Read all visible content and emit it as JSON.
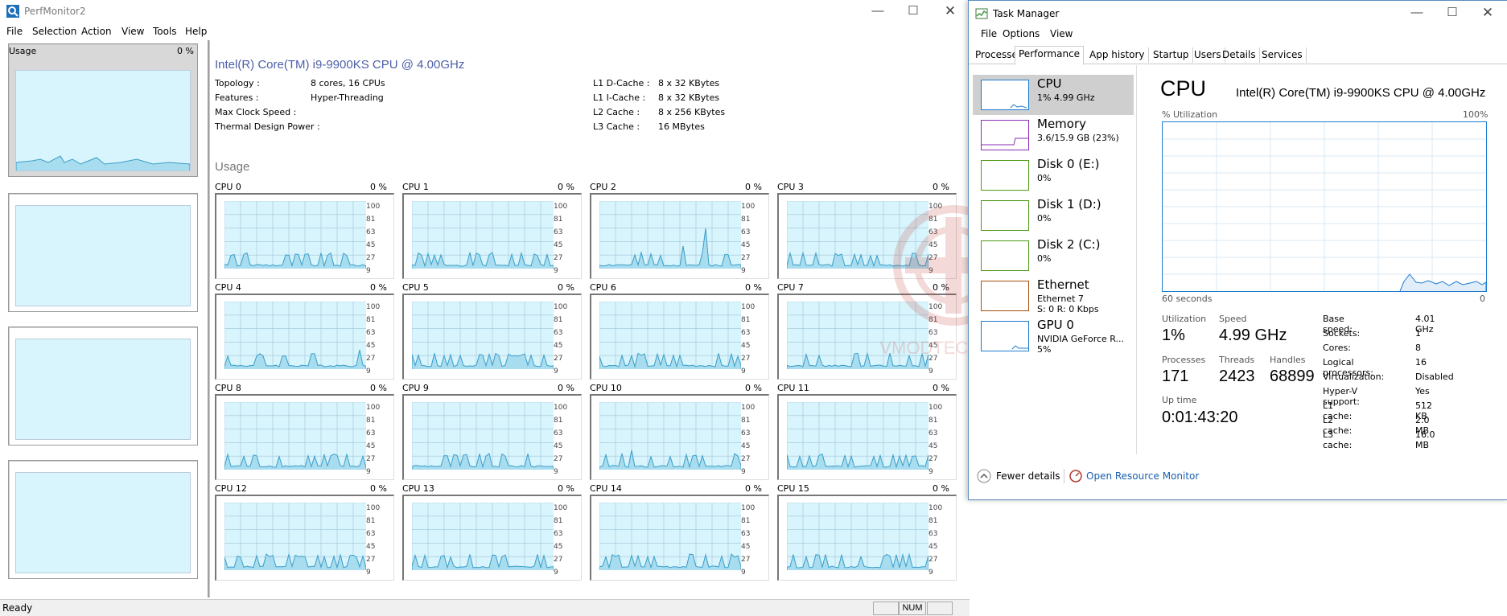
{
  "perfmonitor": {
    "title": "PerfMonitor2",
    "menu": [
      "File",
      "Selection",
      "Action",
      "View",
      "Tools",
      "Help"
    ],
    "left_panel": {
      "label": "Usage",
      "value": "0 %"
    },
    "cpu_name": "Intel(R) Core(TM) i9-9900KS CPU @ 4.00GHz",
    "specs_left": [
      {
        "k": "Topology :",
        "v": "8 cores, 16 CPUs"
      },
      {
        "k": "Features :",
        "v": "Hyper-Threading"
      },
      {
        "k": "Max Clock Speed :",
        "v": ""
      },
      {
        "k": "Thermal Design Power :",
        "v": ""
      }
    ],
    "specs_right": [
      {
        "k": "L1 D-Cache :",
        "v": "8 x 32 KBytes"
      },
      {
        "k": "L1 I-Cache :",
        "v": "8 x 32 KBytes"
      },
      {
        "k": "L2 Cache :",
        "v": "8 x 256 KBytes"
      },
      {
        "k": "L3 Cache :",
        "v": "16 MBytes"
      }
    ],
    "usage_heading": "Usage",
    "axis": [
      "100",
      "81",
      "63",
      "45",
      "27",
      "9"
    ],
    "cores": [
      {
        "label": "CPU 0",
        "value": "0 %"
      },
      {
        "label": "CPU 1",
        "value": "0 %"
      },
      {
        "label": "CPU 2",
        "value": "0 %"
      },
      {
        "label": "CPU 3",
        "value": "0 %"
      },
      {
        "label": "CPU 4",
        "value": "0 %"
      },
      {
        "label": "CPU 5",
        "value": "0 %"
      },
      {
        "label": "CPU 6",
        "value": "0 %"
      },
      {
        "label": "CPU 7",
        "value": "0 %"
      },
      {
        "label": "CPU 8",
        "value": "0 %"
      },
      {
        "label": "CPU 9",
        "value": "0 %"
      },
      {
        "label": "CPU 10",
        "value": "0 %"
      },
      {
        "label": "CPU 11",
        "value": "0 %"
      },
      {
        "label": "CPU 12",
        "value": "0 %"
      },
      {
        "label": "CPU 13",
        "value": "0 %"
      },
      {
        "label": "CPU 14",
        "value": "0 %"
      },
      {
        "label": "CPU 15",
        "value": "0 %"
      }
    ],
    "status": {
      "ready": "Ready",
      "num": "NUM"
    }
  },
  "taskmanager": {
    "title": "Task Manager",
    "menu": [
      "File",
      "Options",
      "View"
    ],
    "tabs": [
      "Processes",
      "Performance",
      "App history",
      "Startup",
      "Users",
      "Details",
      "Services"
    ],
    "active_tab": "Performance",
    "resources": [
      {
        "name": "CPU",
        "sub1": "1% 4.99 GHz",
        "sub2": "",
        "color": "#1b7bcf"
      },
      {
        "name": "Memory",
        "sub1": "3.6/15.9 GB (23%)",
        "sub2": "",
        "color": "#8b2bb8"
      },
      {
        "name": "Disk 0 (E:)",
        "sub1": "0%",
        "sub2": "",
        "color": "#4d9a16"
      },
      {
        "name": "Disk 1 (D:)",
        "sub1": "0%",
        "sub2": "",
        "color": "#4d9a16"
      },
      {
        "name": "Disk 2 (C:)",
        "sub1": "0%",
        "sub2": "",
        "color": "#4d9a16"
      },
      {
        "name": "Ethernet",
        "sub1": "Ethernet 7",
        "sub2": "S: 0 R: 0 Kbps",
        "color": "#a74f0b"
      },
      {
        "name": "GPU 0",
        "sub1": "NVIDIA GeForce R...",
        "sub2": "5%",
        "color": "#1b7bcf"
      }
    ],
    "cpu_heading": "CPU",
    "cpu_name": "Intel(R) Core(TM) i9-9900KS CPU @ 4.00GHz",
    "graph": {
      "top_left": "% Utilization",
      "top_right": "100%",
      "bottom_left": "60 seconds",
      "bottom_right": "0"
    },
    "stats": {
      "utilization_label": "Utilization",
      "utilization": "1%",
      "speed_label": "Speed",
      "speed": "4.99 GHz",
      "processes_label": "Processes",
      "processes": "171",
      "threads_label": "Threads",
      "threads": "2423",
      "handles_label": "Handles",
      "handles": "68899",
      "uptime_label": "Up time",
      "uptime": "0:01:43:20"
    },
    "specs": [
      {
        "k": "Base speed:",
        "v": "4.01 GHz"
      },
      {
        "k": "Sockets:",
        "v": "1"
      },
      {
        "k": "Cores:",
        "v": "8"
      },
      {
        "k": "Logical processors:",
        "v": "16"
      },
      {
        "k": "Virtualization:",
        "v": "Disabled"
      },
      {
        "k": "Hyper-V support:",
        "v": "Yes"
      },
      {
        "k": "L1 cache:",
        "v": "512 KB"
      },
      {
        "k": "L2 cache:",
        "v": "2.0 MB"
      },
      {
        "k": "L3 cache:",
        "v": "16.0 MB"
      }
    ],
    "footer": {
      "fewer": "Fewer details",
      "resmon": "Open Resource Monitor"
    }
  },
  "watermark": "VMODTECH.COM"
}
